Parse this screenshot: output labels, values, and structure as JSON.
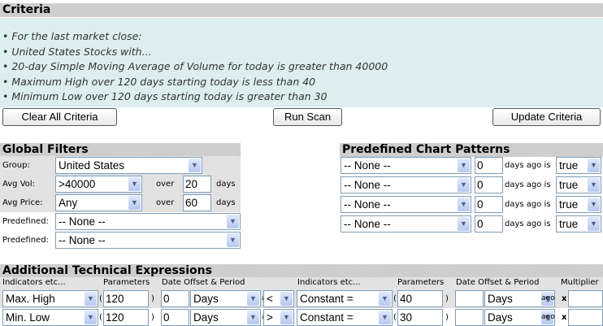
{
  "criteria": {
    "title": "Criteria",
    "lines": [
      "For the last market close:",
      "United States Stocks with...",
      "20-day Simple Moving Average of Volume for today is greater than 40000",
      "Maximum High over 120 days starting today is less than 40",
      "Minimum Low over 120 days starting today is greater than 30"
    ]
  },
  "buttons": {
    "clear": "Clear All Criteria",
    "run": "Run Scan",
    "update": "Update Criteria"
  },
  "global": {
    "title": "Global Filters",
    "group_label": "Group:",
    "group": "United States",
    "avgvol_label": "Avg Vol:",
    "avgvol": ">40000",
    "avgvol_over": "20",
    "avgprice_label": "Avg Price:",
    "avgprice": "Any",
    "avgprice_over": "60",
    "over": "over",
    "days": "days",
    "predef_label": "Predefined:",
    "predef1": "-- None --",
    "predef2": "-- None --"
  },
  "patterns": {
    "title": "Predefined Chart Patterns",
    "days_ago_is": "days ago is",
    "rows": [
      {
        "pattern": "-- None --",
        "days": "0",
        "value": "true"
      },
      {
        "pattern": "-- None --",
        "days": "0",
        "value": "true"
      },
      {
        "pattern": "-- None --",
        "days": "0",
        "value": "true"
      },
      {
        "pattern": "-- None --",
        "days": "0",
        "value": "true"
      }
    ]
  },
  "tech": {
    "title": "Additional Technical Expressions",
    "headers": [
      "Indicators etc...",
      "Parameters",
      "Date Offset & Period",
      "Indicators etc...",
      "Parameters",
      "Date Offset & Period",
      "Multiplier"
    ],
    "ago": "ago",
    "x": "x",
    "open": "(",
    "close": ")",
    "rows": [
      {
        "ind": "Max. High",
        "param": "120",
        "offset": "0",
        "period": "Days",
        "op": "<",
        "ind2": "Constant =",
        "param2": "40",
        "offset2": "",
        "period2": "Days",
        "mult": ""
      },
      {
        "ind": "Min. Low",
        "param": "120",
        "offset": "0",
        "period": "Days",
        "op": ">",
        "ind2": "Constant =",
        "param2": "30",
        "offset2": "",
        "period2": "Days",
        "mult": ""
      }
    ]
  }
}
